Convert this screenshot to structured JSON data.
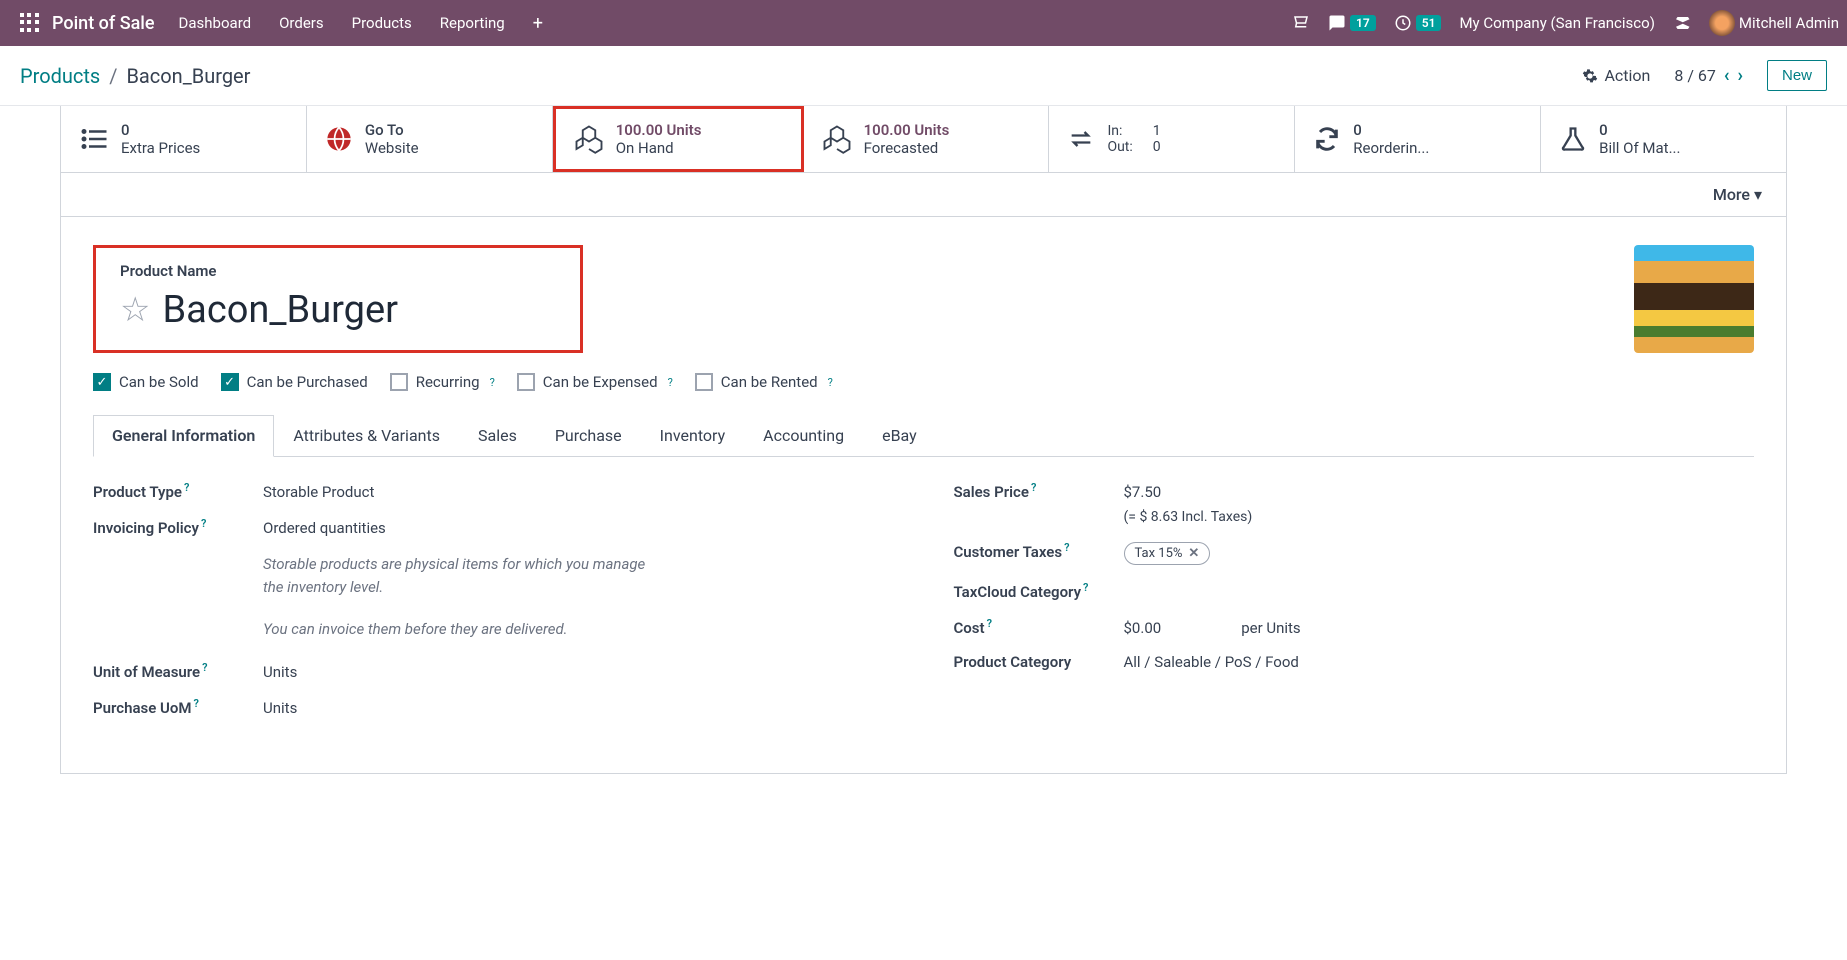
{
  "topbar": {
    "brand": "Point of Sale",
    "nav": [
      "Dashboard",
      "Orders",
      "Products",
      "Reporting"
    ],
    "messages_badge": "17",
    "activities_badge": "51",
    "company": "My Company (San Francisco)",
    "user_name": "Mitchell Admin"
  },
  "breadcrumb": {
    "parent": "Products",
    "current": "Bacon_Burger"
  },
  "subheader": {
    "action": "Action",
    "pager": "8 / 67",
    "new_btn": "New"
  },
  "stats": {
    "extra_prices": {
      "value": "0",
      "label": "Extra Prices"
    },
    "website": {
      "line1": "Go To",
      "line2": "Website"
    },
    "onhand": {
      "value": "100.00 Units",
      "label": "On Hand"
    },
    "forecast": {
      "value": "100.00 Units",
      "label": "Forecasted"
    },
    "in_label": "In:",
    "in_val": "1",
    "out_label": "Out:",
    "out_val": "0",
    "reorder": {
      "value": "0",
      "label": "Reorderin..."
    },
    "bom": {
      "value": "0",
      "label": "Bill Of Mat..."
    },
    "more": "More"
  },
  "product": {
    "name_label": "Product Name",
    "name": "Bacon_Burger",
    "checks": {
      "sold": "Can be Sold",
      "purchased": "Can be Purchased",
      "recurring": "Recurring",
      "expensed": "Can be Expensed",
      "rented": "Can be Rented"
    }
  },
  "tabs": [
    "General Information",
    "Attributes & Variants",
    "Sales",
    "Purchase",
    "Inventory",
    "Accounting",
    "eBay"
  ],
  "fields": {
    "product_type_label": "Product Type",
    "product_type_value": "Storable Product",
    "invoicing_label": "Invoicing Policy",
    "invoicing_value": "Ordered quantities",
    "help1": "Storable products are physical items for which you manage the inventory level.",
    "help2": "You can invoice them before they are delivered.",
    "uom_label": "Unit of Measure",
    "uom_value": "Units",
    "purchase_uom_label": "Purchase UoM",
    "purchase_uom_value": "Units",
    "sales_price_label": "Sales Price",
    "sales_price_value": "$7.50",
    "incl_taxes": "(= $ 8.63 Incl. Taxes)",
    "cust_taxes_label": "Customer Taxes",
    "tax_tag": "Tax 15%",
    "taxcloud_label": "TaxCloud Category",
    "cost_label": "Cost",
    "cost_value": "$0.00",
    "cost_per": "per Units",
    "category_label": "Product Category",
    "category_value": "All / Saleable / PoS / Food"
  }
}
